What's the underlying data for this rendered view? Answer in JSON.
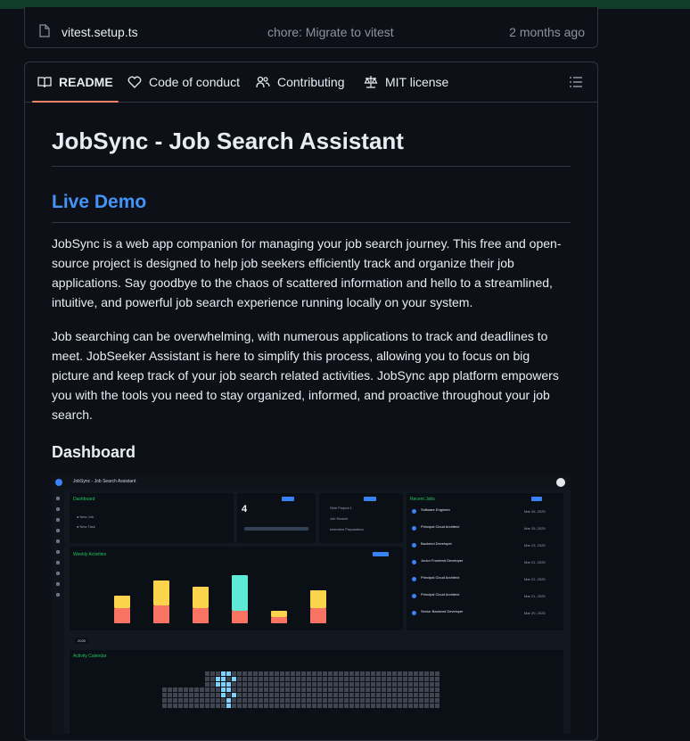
{
  "file_row": {
    "name": "vitest.setup.ts",
    "commit": "chore: Migrate to vitest",
    "time": "2 months ago"
  },
  "tabs": [
    {
      "label": "README",
      "icon": "book-icon",
      "active": true
    },
    {
      "label": "Code of conduct",
      "icon": "heart-icon",
      "active": false
    },
    {
      "label": "Contributing",
      "icon": "people-icon",
      "active": false
    },
    {
      "label": "MIT license",
      "icon": "scale-icon",
      "active": false
    }
  ],
  "readme": {
    "title": "JobSync - Job Search Assistant",
    "live_demo": "Live Demo",
    "para1": "JobSync is a web app companion for managing your job search journey. This free and open-source project is designed to help job seekers efficiently track and organize their job applications. Say goodbye to the chaos of scattered information and hello to a streamlined, intuitive, and powerful job search experience running locally on your system.",
    "para2": "Job searching can be overwhelming, with numerous applications to track and deadlines to meet. JobSeeker Assistant is here to simplify this process, allowing you to focus on big picture and keep track of your job search related activities. JobSync app platform empowers you with the tools you need to stay organized, informed, and proactive throughout your job search.",
    "dashboard_heading": "Dashboard"
  },
  "screenshot": {
    "app_title": "JobSync - Job Search Assistant",
    "dashboard_title": "Dashboard",
    "new_job": "New Job",
    "new_task": "New Task",
    "big_number": "4",
    "weekly_title": "Weekly Activities",
    "recent_title": "Recent Jobs",
    "calendar_title": "Activity Calendar",
    "calendar_year": "2025",
    "activities": [
      "Side Project 1",
      "Job Search",
      "Interview Preparation"
    ],
    "recent_jobs": [
      {
        "title": "Software Engineer",
        "date": "Mar 26, 2025"
      },
      {
        "title": "Principal Cloud Architect",
        "date": "Mar 25, 2025"
      },
      {
        "title": "Backend Developer",
        "date": "Mar 23, 2025"
      },
      {
        "title": "Junior Frontend Developer",
        "date": "Mar 21, 2025"
      },
      {
        "title": "Principal Cloud Architect",
        "date": "Mar 22, 2025"
      },
      {
        "title": "Principal Cloud Architect",
        "date": "Mar 21, 2025"
      },
      {
        "title": "Senior Backend Developer",
        "date": "Mar 20, 2025"
      }
    ],
    "weekly_bars": [
      {
        "bottom": 0.5,
        "top": 0.4
      },
      {
        "bottom": 0.6,
        "top": 0.8
      },
      {
        "bottom": 0.5,
        "top": 0.7
      },
      {
        "bottom": 0.4,
        "top": 1.2
      },
      {
        "bottom": 0.2,
        "top": 0.2
      },
      {
        "bottom": 0.5,
        "top": 0.6
      },
      {
        "bottom": 0.0,
        "top": 0.0
      }
    ]
  },
  "colors": {
    "accent": "#4493f8",
    "tab_underline": "#f78166",
    "green": "#22c55e",
    "bar_orange": "#f97362",
    "bar_yellow": "#fcd34d",
    "bar_teal": "#5eead4"
  }
}
